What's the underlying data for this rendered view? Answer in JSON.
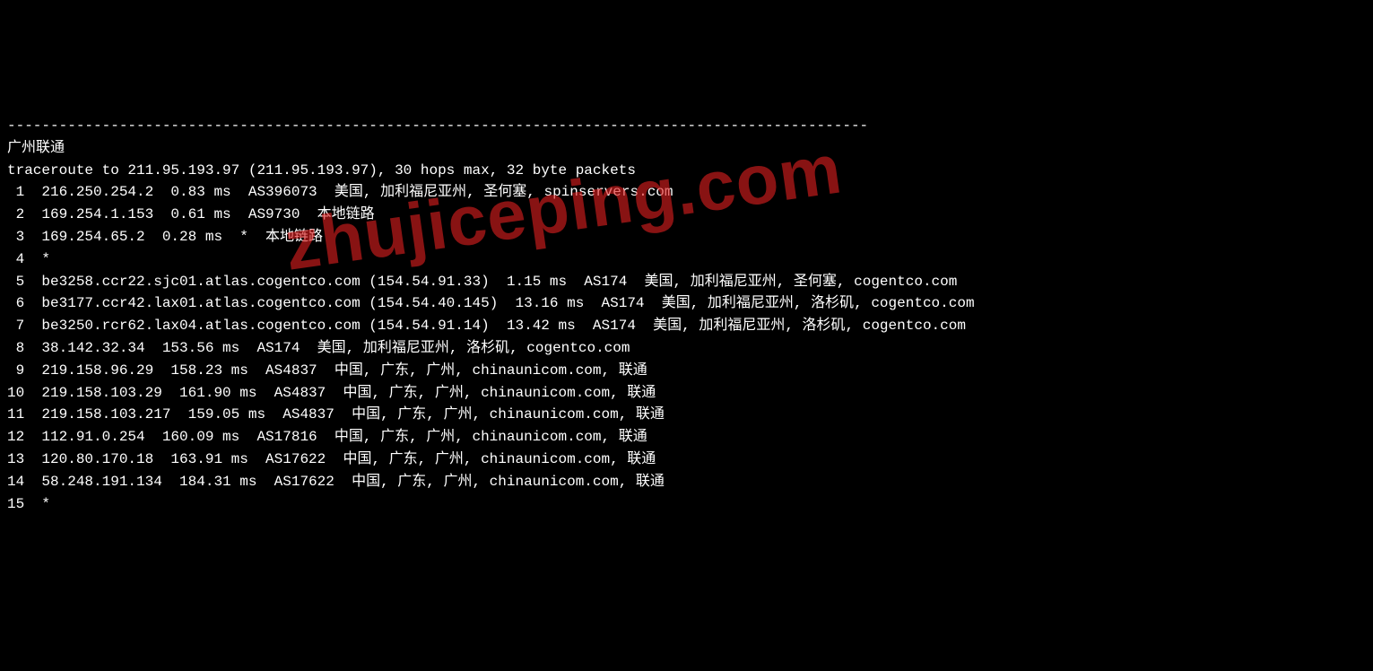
{
  "watermark": "zhujiceping.com",
  "dashes": "----------------------------------------------------------------------------------------------------",
  "title": "广州联通",
  "header": "traceroute to 211.95.193.97 (211.95.193.97), 30 hops max, 32 byte packets",
  "hops": [
    " 1  216.250.254.2  0.83 ms  AS396073  美国, 加利福尼亚州, 圣何塞, spinservers.com",
    " 2  169.254.1.153  0.61 ms  AS9730  本地链路",
    " 3  169.254.65.2  0.28 ms  *  本地链路",
    " 4  *",
    " 5  be3258.ccr22.sjc01.atlas.cogentco.com (154.54.91.33)  1.15 ms  AS174  美国, 加利福尼亚州, 圣何塞, cogentco.com",
    " 6  be3177.ccr42.lax01.atlas.cogentco.com (154.54.40.145)  13.16 ms  AS174  美国, 加利福尼亚州, 洛杉矶, cogentco.com",
    " 7  be3250.rcr62.lax04.atlas.cogentco.com (154.54.91.14)  13.42 ms  AS174  美国, 加利福尼亚州, 洛杉矶, cogentco.com",
    " 8  38.142.32.34  153.56 ms  AS174  美国, 加利福尼亚州, 洛杉矶, cogentco.com",
    " 9  219.158.96.29  158.23 ms  AS4837  中国, 广东, 广州, chinaunicom.com, 联通",
    "10  219.158.103.29  161.90 ms  AS4837  中国, 广东, 广州, chinaunicom.com, 联通",
    "11  219.158.103.217  159.05 ms  AS4837  中国, 广东, 广州, chinaunicom.com, 联通",
    "12  112.91.0.254  160.09 ms  AS17816  中国, 广东, 广州, chinaunicom.com, 联通",
    "13  120.80.170.18  163.91 ms  AS17622  中国, 广东, 广州, chinaunicom.com, 联通",
    "14  58.248.191.134  184.31 ms  AS17622  中国, 广东, 广州, chinaunicom.com, 联通",
    "15  *"
  ]
}
